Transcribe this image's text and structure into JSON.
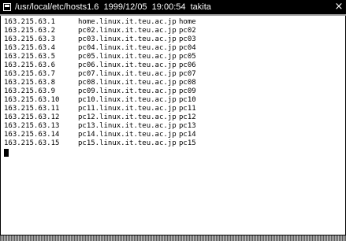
{
  "window": {
    "title": "/usr/local/etc/hosts1.6  1999/12/05  19:00:54  takita",
    "close_glyph": "×"
  },
  "hosts": [
    {
      "ip": "163.215.63.1",
      "fqdn": "home.linux.it.teu.ac.jp",
      "name": "home"
    },
    {
      "ip": "163.215.63.2",
      "fqdn": "pc02.linux.it.teu.ac.jp",
      "name": "pc02"
    },
    {
      "ip": "163.215.63.3",
      "fqdn": "pc03.linux.it.teu.ac.jp",
      "name": "pc03"
    },
    {
      "ip": "163.215.63.4",
      "fqdn": "pc04.linux.it.teu.ac.jp",
      "name": "pc04"
    },
    {
      "ip": "163.215.63.5",
      "fqdn": "pc05.linux.it.teu.ac.jp",
      "name": "pc05"
    },
    {
      "ip": "163.215.63.6",
      "fqdn": "pc06.linux.it.teu.ac.jp",
      "name": "pc06"
    },
    {
      "ip": "163.215.63.7",
      "fqdn": "pc07.linux.it.teu.ac.jp",
      "name": "pc07"
    },
    {
      "ip": "163.215.63.8",
      "fqdn": "pc08.linux.it.teu.ac.jp",
      "name": "pc08"
    },
    {
      "ip": "163.215.63.9",
      "fqdn": "pc09.linux.it.teu.ac.jp",
      "name": "pc09"
    },
    {
      "ip": "163.215.63.10",
      "fqdn": "pc10.linux.it.teu.ac.jp",
      "name": "pc10"
    },
    {
      "ip": "163.215.63.11",
      "fqdn": "pc11.linux.it.teu.ac.jp",
      "name": "pc11"
    },
    {
      "ip": "163.215.63.12",
      "fqdn": "pc12.linux.it.teu.ac.jp",
      "name": "pc12"
    },
    {
      "ip": "163.215.63.13",
      "fqdn": "pc13.linux.it.teu.ac.jp",
      "name": "pc13"
    },
    {
      "ip": "163.215.63.14",
      "fqdn": "pc14.linux.it.teu.ac.jp",
      "name": "pc14"
    },
    {
      "ip": "163.215.63.15",
      "fqdn": "pc15.linux.it.teu.ac.jp",
      "name": "pc15"
    }
  ],
  "icons": {
    "window_menu": "window-menu-icon",
    "close": "close-icon"
  }
}
